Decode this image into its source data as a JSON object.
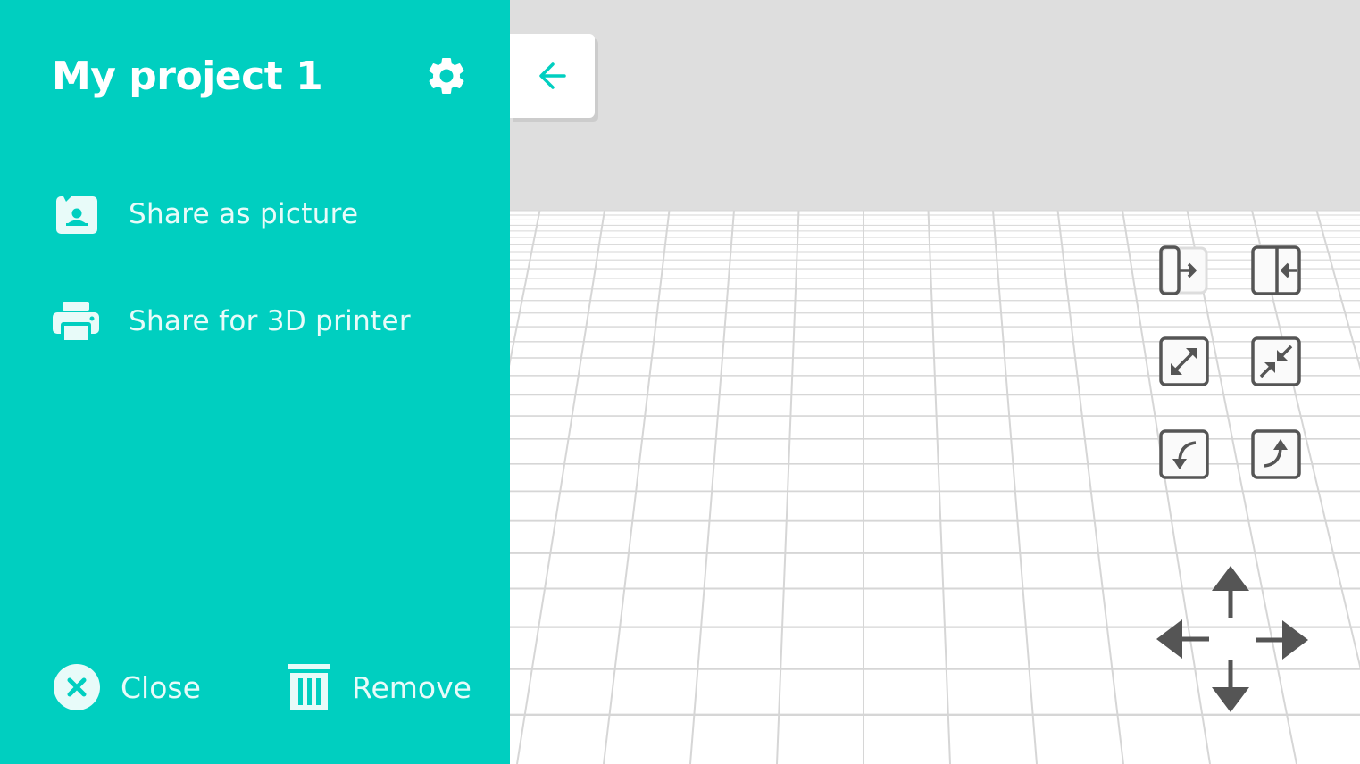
{
  "project": {
    "title": "My project 1"
  },
  "menu": {
    "share_picture_label": "Share as picture",
    "share_printer_label": "Share for 3D printer"
  },
  "footer": {
    "close_label": "Close",
    "remove_label": "Remove"
  },
  "colors": {
    "accent": "#00cfc0",
    "tool_icon": "#555555",
    "back_arrow": "#00cfc0"
  },
  "icons": {
    "settings": "gear-icon",
    "share_picture": "image-icon",
    "share_printer": "printer-icon",
    "close": "close-circle-icon",
    "remove": "trash-icon",
    "back": "arrow-left-icon"
  }
}
